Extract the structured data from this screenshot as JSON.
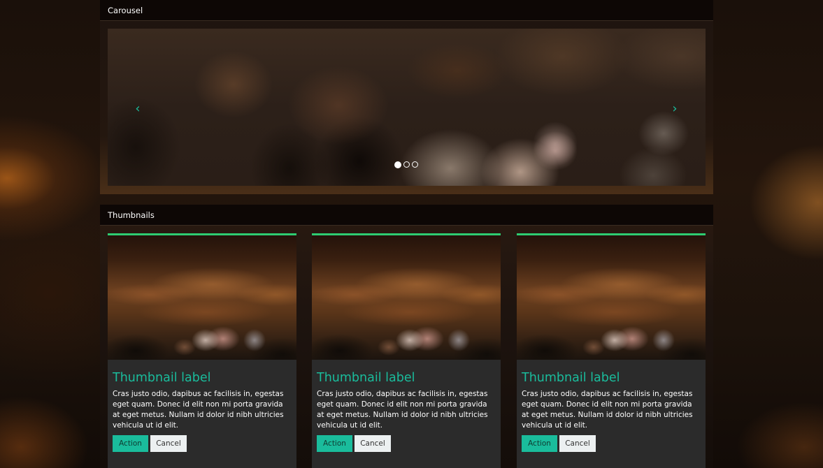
{
  "carousel": {
    "heading": "Carousel",
    "prev_glyph": "‹",
    "next_glyph": "›",
    "slide_count": 3,
    "active_slide": 1
  },
  "thumbnails": {
    "heading": "Thumbnails",
    "items": [
      {
        "title": "Thumbnail label",
        "text": "Cras justo odio, dapibus ac facilisis in, egestas eget quam. Donec id elit non mi porta gravida at eget metus. Nullam id dolor id nibh ultricies vehicula ut id elit.",
        "action_label": "Action",
        "cancel_label": "Cancel"
      },
      {
        "title": "Thumbnail label",
        "text": "Cras justo odio, dapibus ac facilisis in, egestas eget quam. Donec id elit non mi porta gravida at eget metus. Nullam id dolor id nibh ultricies vehicula ut id elit.",
        "action_label": "Action",
        "cancel_label": "Cancel"
      },
      {
        "title": "Thumbnail label",
        "text": "Cras justo odio, dapibus ac facilisis in, egestas eget quam. Donec id elit non mi porta gravida at eget metus. Nullam id dolor id nibh ultricies vehicula ut id elit.",
        "action_label": "Action",
        "cancel_label": "Cancel"
      }
    ]
  },
  "colors": {
    "accent": "#1abc9c",
    "thumb_border": "#2ecc71",
    "caption_bg": "#2b2b2b",
    "cancel_bg": "#ecf0f1"
  }
}
